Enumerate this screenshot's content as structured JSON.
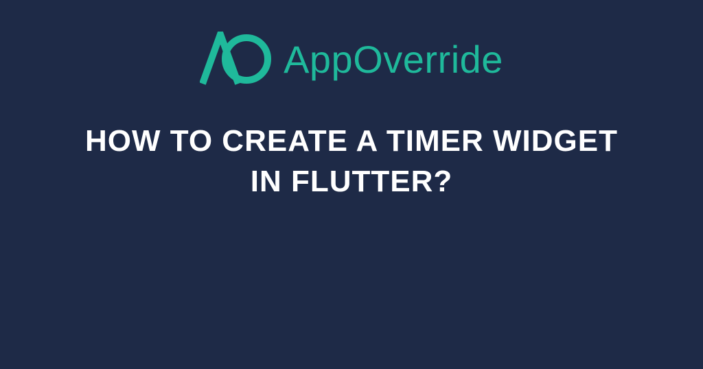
{
  "brand": {
    "name": "AppOverride",
    "accent_color": "#1fb99b"
  },
  "headline": "HOW TO CREATE A TIMER WIDGET IN FLUTTER?",
  "colors": {
    "background": "#1e2a47",
    "accent": "#1fb99b",
    "text": "#ffffff"
  }
}
